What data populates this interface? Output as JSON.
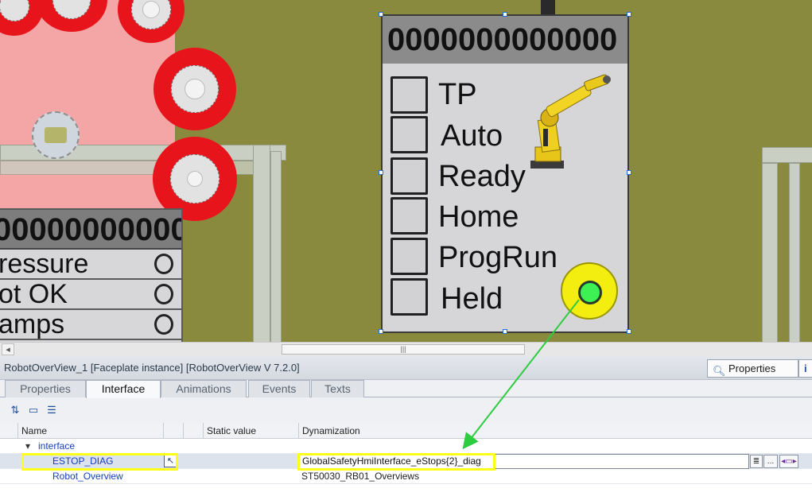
{
  "canvas": {
    "left_panel": {
      "header": "000000000000",
      "rows": [
        "ressure",
        "ot OK",
        "amps"
      ]
    },
    "faceplate": {
      "title": "0000000000000",
      "items": [
        "TP",
        "Auto",
        "Ready",
        "Home",
        "ProgRun",
        "Held"
      ],
      "robot_icon": "industrial-robot-arm-icon",
      "estop_indicator_color": "#3df054",
      "estop_ring_color": "#f3ee10"
    }
  },
  "scrollbar": {
    "left_arrow": "◂",
    "thumb_grip": "|||"
  },
  "inspector": {
    "title": "RobotOverView_1 [Faceplate instance] [RobotOverView V 7.2.0]",
    "properties_button": "Properties",
    "info_button": "i",
    "tabs": [
      "Properties",
      "Interface",
      "Animations",
      "Events",
      "Texts"
    ],
    "active_tab": "Interface",
    "columns": {
      "name": "Name",
      "static_value": "Static value",
      "dynamization": "Dynamization"
    },
    "group": "interface",
    "rows": [
      {
        "name": "ESTOP_DIAG",
        "dynamization": "GlobalSafetyHmiInterface_eStops{2}_diag"
      },
      {
        "name": "Robot_Overview",
        "dynamization": "ST50030_RB01_Overviews"
      }
    ],
    "row_buttons": {
      "list": "≣",
      "browse": "...",
      "tag": "◂▭▸"
    }
  },
  "annotation": {
    "highlight_color": "#ffff1a",
    "arrow_color": "#2ecc40"
  }
}
